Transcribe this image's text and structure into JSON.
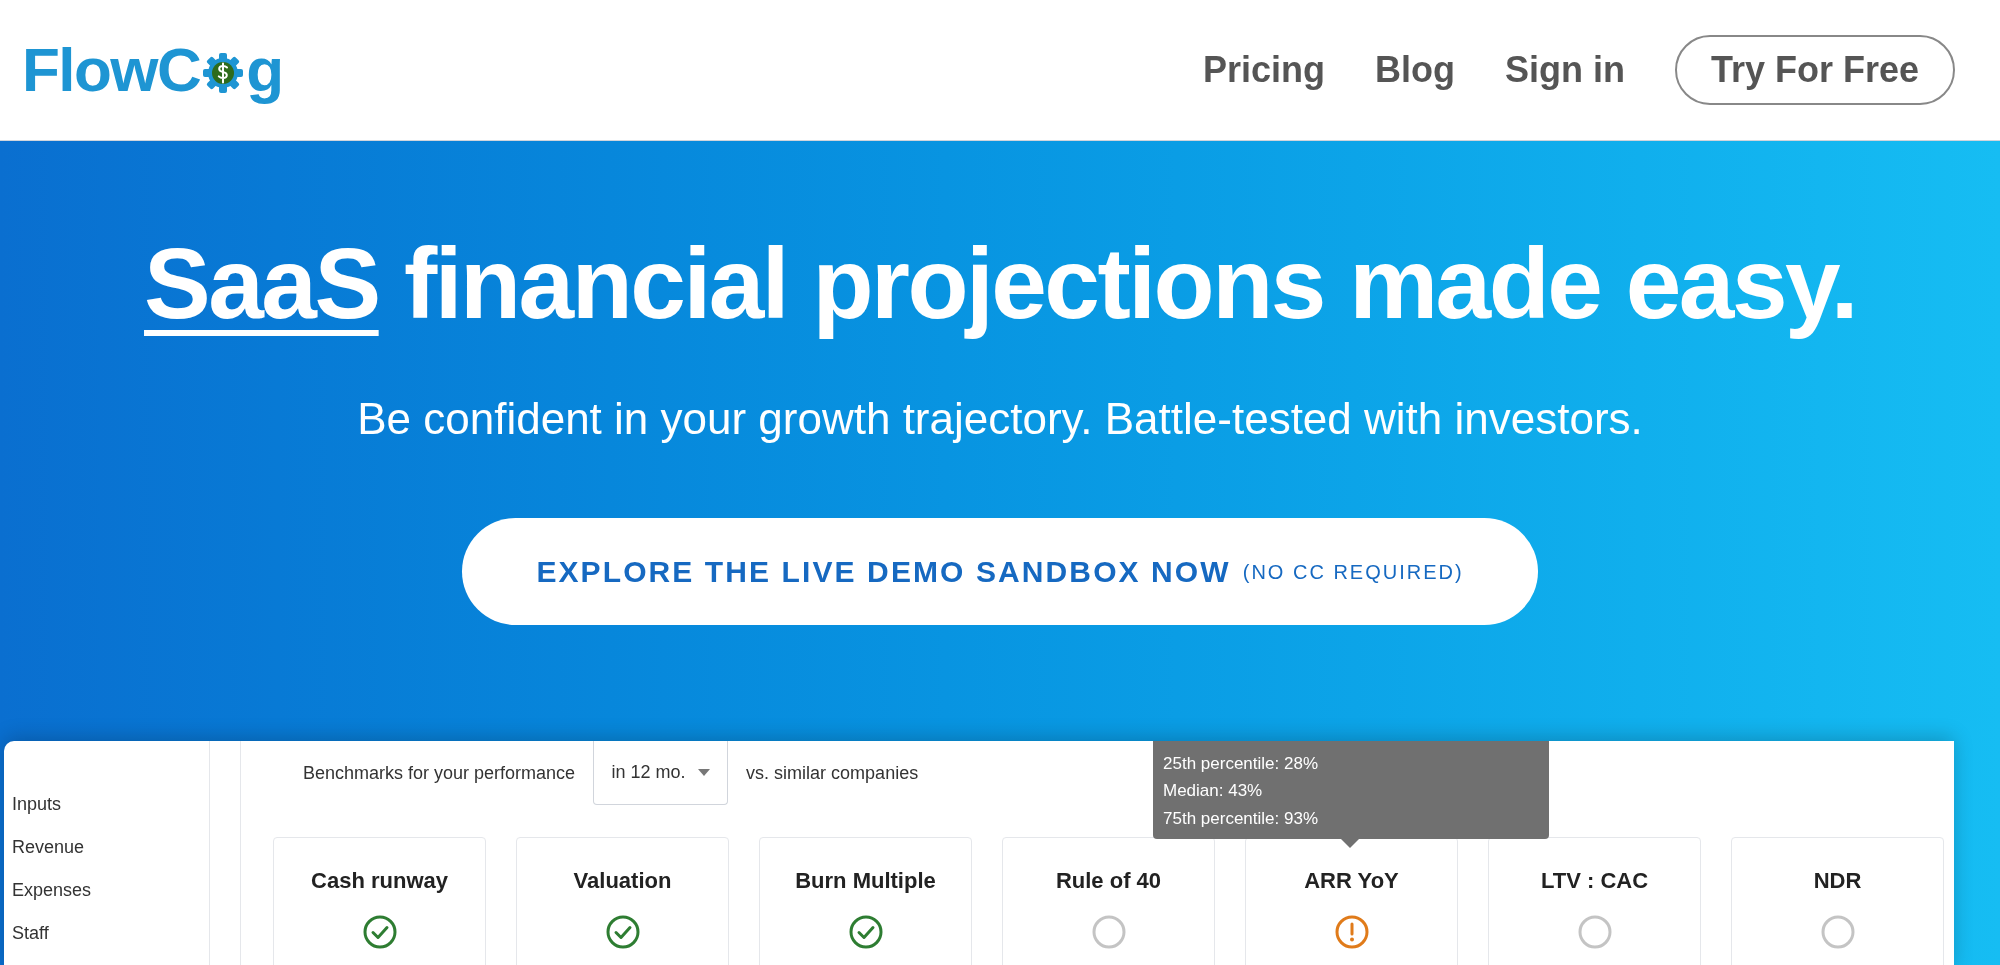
{
  "header": {
    "logo": {
      "before": "FlowC",
      "after": "g"
    },
    "nav": [
      {
        "label": "Pricing",
        "kind": "link"
      },
      {
        "label": "Blog",
        "kind": "link"
      },
      {
        "label": "Sign in",
        "kind": "link"
      },
      {
        "label": "Try For Free",
        "kind": "button"
      }
    ]
  },
  "hero": {
    "headline_link": "SaaS",
    "headline": "financial projections made easy.",
    "subtitle": "Be confident in your growth trajectory. Battle-tested with investors.",
    "cta": {
      "label": "EXPLORE THE LIVE DEMO SANDBOX NOW",
      "note": "(NO CC REQUIRED)"
    }
  },
  "app": {
    "sidebar": {
      "items": [
        "Inputs",
        "Revenue",
        "Expenses",
        "Staff"
      ]
    },
    "benchmarks": {
      "label": "Benchmarks for your performance",
      "period": "in 12 mo.",
      "suffix": "vs. similar companies"
    },
    "tooltip": [
      "25th percentile: 28%",
      "Median: 43%",
      "75th percentile: 93%"
    ],
    "cards": [
      {
        "title": "Cash runway",
        "kind": "ok"
      },
      {
        "title": "Valuation",
        "kind": "ok"
      },
      {
        "title": "Burn Multiple",
        "kind": "ok"
      },
      {
        "title": "Rule of 40",
        "kind": "none"
      },
      {
        "title": "ARR YoY",
        "kind": "warning"
      },
      {
        "title": "LTV : CAC",
        "kind": "none"
      },
      {
        "title": "NDR",
        "kind": "none"
      }
    ]
  }
}
